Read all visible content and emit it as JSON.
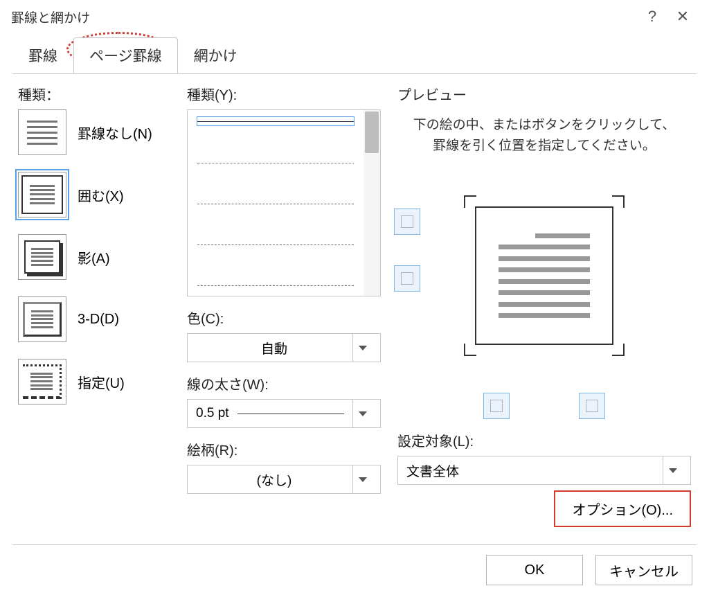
{
  "window": {
    "title": "罫線と網かけ"
  },
  "tabs": {
    "t1": "罫線",
    "t2": "ページ罫線",
    "t3": "網かけ"
  },
  "col1": {
    "label": "種類：",
    "none": "罫線なし(N)",
    "box": "囲む(X)",
    "shadow": "影(A)",
    "threeD": "3-D(D)",
    "custom": "指定(U)"
  },
  "col2": {
    "styleLabel": "種類(Y):",
    "colorLabel": "色(C):",
    "colorValue": "自動",
    "widthLabel": "線の太さ(W):",
    "widthValue": "0.5 pt",
    "artLabel": "絵柄(R):",
    "artValue": "(なし)"
  },
  "col3": {
    "previewLabel": "プレビュー",
    "previewDesc": "下の絵の中、またはボタンをクリックして、罫線を引く位置を指定してください。",
    "applyLabel": "設定対象(L):",
    "applyValue": "文書全体",
    "options": "オプション(O)..."
  },
  "footer": {
    "ok": "OK",
    "cancel": "キャンセル"
  }
}
